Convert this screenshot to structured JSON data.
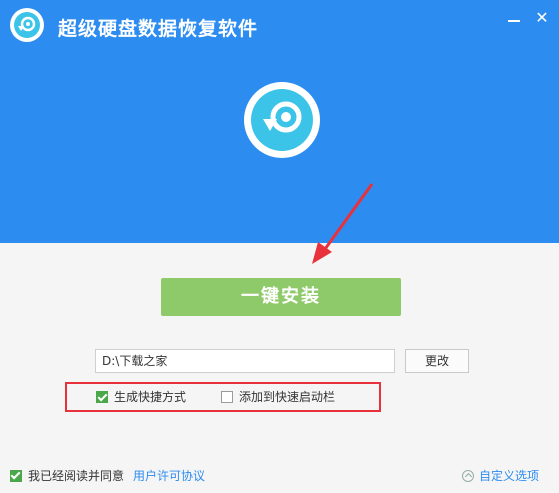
{
  "window": {
    "title": "超级硬盘数据恢复软件",
    "minimize_icon": "minimize-icon",
    "close_icon": "close-icon",
    "close_glyph": "✕"
  },
  "brand": {
    "logo_icon": "recovery-logo-icon",
    "accent": "#2d8cf0",
    "logo_color": "#3cc4e8"
  },
  "install": {
    "label": "一键安装",
    "color": "#8fca6a"
  },
  "path": {
    "value": "D:\\下载之家",
    "change_label": "更改"
  },
  "options": [
    {
      "label": "生成快捷方式",
      "checked": true
    },
    {
      "label": "添加到快速启动栏",
      "checked": false
    }
  ],
  "footer": {
    "agree_label": "我已经阅读并同意",
    "agree_checked": true,
    "license_link": "用户许可协议",
    "custom_options": "自定义选项"
  },
  "annotation": {
    "highlight_color": "#e8313a"
  }
}
